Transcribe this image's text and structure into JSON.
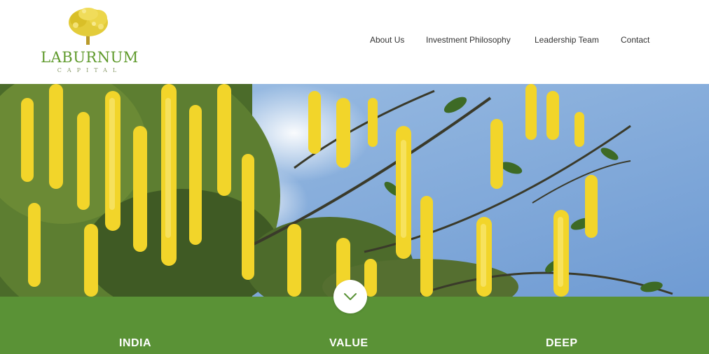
{
  "brand": {
    "name": "LABURNUM",
    "tagline": "CAPITAL",
    "logo_icon": "laburnum-tree-icon",
    "color": "#5f9a2c"
  },
  "nav": {
    "items": [
      {
        "label": "About Us"
      },
      {
        "label": "Investment Philosophy"
      },
      {
        "label": "Leadership Team"
      },
      {
        "label": "Contact"
      }
    ]
  },
  "hero": {
    "image": "laburnum-flowers-photo",
    "scroll_icon": "chevron-down-icon"
  },
  "band": {
    "color": "#5a9236",
    "pillars": [
      {
        "label": "INDIA"
      },
      {
        "label": "VALUE"
      },
      {
        "label": "DEEP"
      }
    ]
  }
}
